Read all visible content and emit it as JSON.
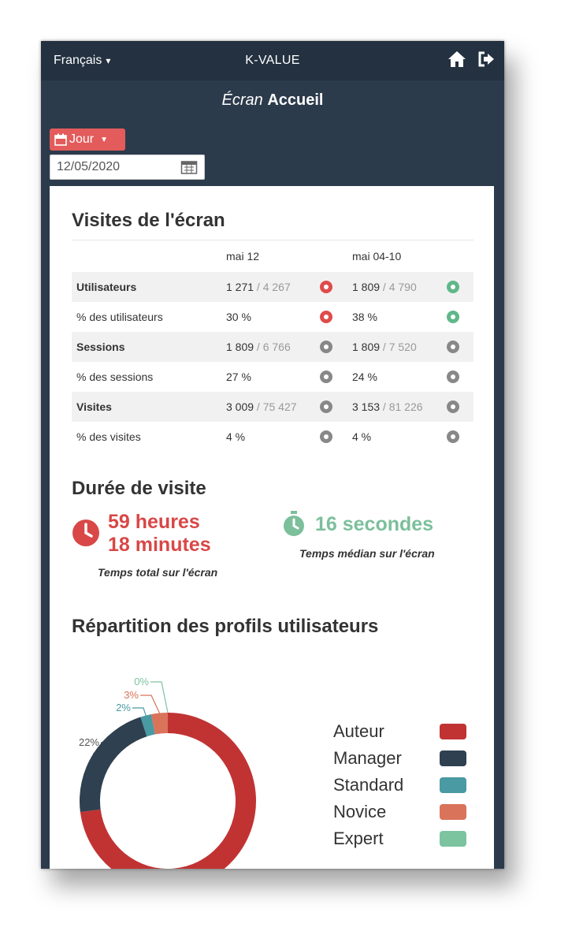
{
  "app": {
    "language": "Français",
    "brand": "K-VALUE",
    "screen_title_prefix": "Écran",
    "screen_title_name": "Accueil"
  },
  "controls": {
    "period_label": "Jour",
    "date_value": "12/05/2020"
  },
  "visits": {
    "title": "Visites de l'écran",
    "col1": "mai 12",
    "col2": "mai 04-10",
    "rows": [
      {
        "label": "Utilisateurs",
        "v1": "1 271",
        "t1": " / 4 267",
        "i1": "red",
        "v2": "1 809",
        "t2": " / 4 790",
        "i2": "green"
      },
      {
        "label": "% des utilisateurs",
        "v1": "30 %",
        "t1": "",
        "i1": "red",
        "v2": "38 %",
        "t2": "",
        "i2": "green"
      },
      {
        "label": "Sessions",
        "v1": "1 809",
        "t1": " / 6 766",
        "i1": "gray",
        "v2": "1 809",
        "t2": " / 7 520",
        "i2": "gray"
      },
      {
        "label": "% des sessions",
        "v1": "27 %",
        "t1": "",
        "i1": "gray",
        "v2": "24 %",
        "t2": "",
        "i2": "gray"
      },
      {
        "label": "Visites",
        "v1": "3 009",
        "t1": " / 75 427",
        "i1": "gray",
        "v2": "3 153",
        "t2": " / 81 226",
        "i2": "gray"
      },
      {
        "label": "% des visites",
        "v1": "4 %",
        "t1": "",
        "i1": "gray",
        "v2": "4 %",
        "t2": "",
        "i2": "gray"
      }
    ]
  },
  "duration": {
    "title": "Durée de visite",
    "total_line1": "59 heures",
    "total_line2": "18 minutes",
    "total_caption": "Temps total sur l'écran",
    "median": "16 secondes",
    "median_caption": "Temps médian sur l'écran"
  },
  "profiles": {
    "title": "Répartition des profils utilisateurs"
  },
  "chart_data": {
    "type": "pie",
    "donut": true,
    "categories": [
      "Auteur",
      "Manager",
      "Standard",
      "Novice",
      "Expert"
    ],
    "values": [
      73,
      22,
      2,
      3,
      0
    ],
    "labels": [
      "",
      "22%",
      "2%",
      "3%",
      "0%"
    ],
    "colors": [
      "#c13333",
      "#2f4050",
      "#4a9aa3",
      "#d9735a",
      "#7cc3a0"
    ],
    "legend_position": "right"
  }
}
